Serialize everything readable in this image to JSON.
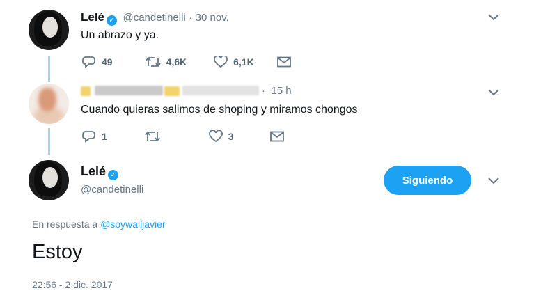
{
  "tweet1": {
    "name": "Lelé",
    "handle": "@candetinelli",
    "separator": "·",
    "date": "30 nov.",
    "text": "Un abrazo y ya.",
    "replies": "49",
    "retweets": "4,6K",
    "likes": "6,1K"
  },
  "tweet2": {
    "separator": "·",
    "time": "15 h",
    "text": "Cuando quieras salimos de shoping y miramos chongos",
    "replies": "1",
    "likes": "3"
  },
  "main_tweet": {
    "name": "Lelé",
    "handle": "@candetinelli",
    "follow_label": "Siguiendo",
    "reply_prefix": "En respuesta a",
    "reply_to": "@soywalljavier",
    "text": "Estoy",
    "timestamp": "22:56 - 2 dic. 2017"
  },
  "colors": {
    "accent": "#1da1f2",
    "thread_line": "#a9cfe8",
    "secondary_text": "#657786"
  }
}
